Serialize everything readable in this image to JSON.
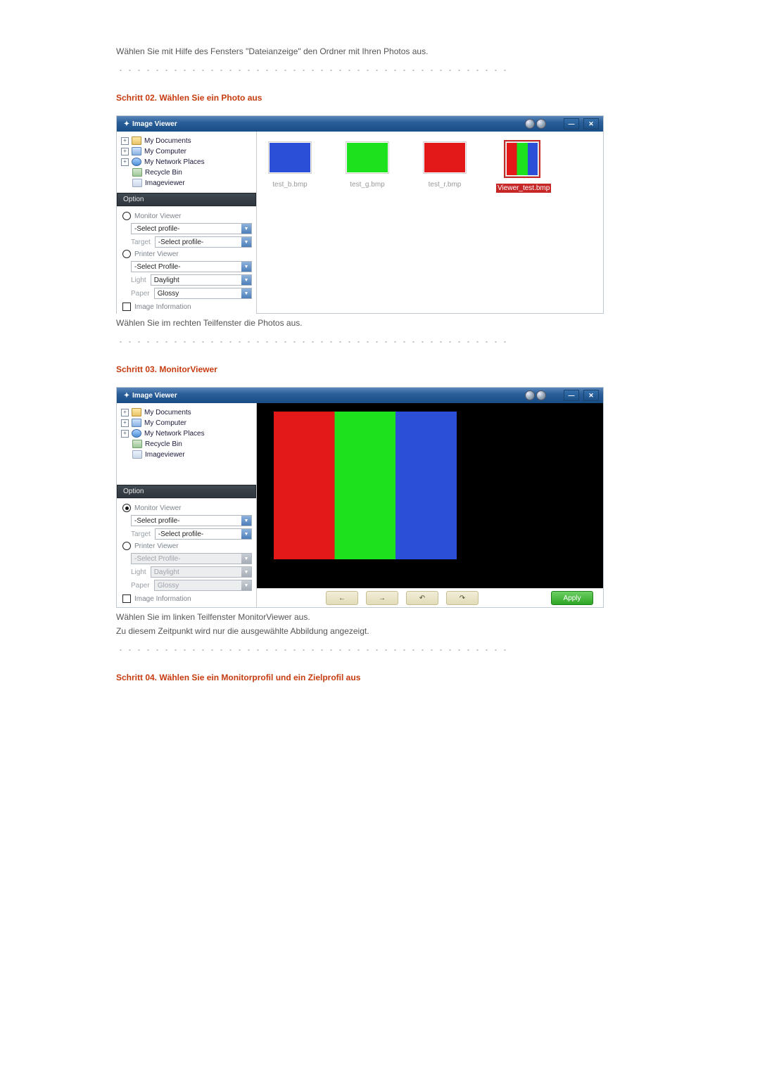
{
  "intro_text": "Wählen Sie mit Hilfe des Fensters \"Dateianzeige\" den Ordner mit Ihren Photos aus.",
  "step2": {
    "title": "Schritt 02. Wählen Sie ein Photo aus",
    "caption": "Wählen Sie im rechten Teilfenster die Photos aus."
  },
  "step3": {
    "title": "Schritt 03. MonitorViewer",
    "caption1": "Wählen Sie im linken Teilfenster MonitorViewer aus.",
    "caption2": "Zu diesem Zeitpunkt wird nur die ausgewählte Abbildung angezeigt."
  },
  "step4": {
    "title": "Schritt 04. Wählen Sie ein Monitorprofil und ein Zielprofil aus"
  },
  "app": {
    "title": "Image Viewer",
    "tree": {
      "my_documents": "My Documents",
      "my_computer": "My Computer",
      "my_network_places": "My Network Places",
      "recycle_bin": "Recycle Bin",
      "imageviewer": "Imageviewer"
    },
    "option_header": "Option",
    "monitor_viewer": "Monitor Viewer",
    "printer_viewer": "Printer Viewer",
    "select_profile": "-Select profile-",
    "select_profile_cap": "-Select Profile-",
    "target_label": "Target",
    "light_label": "Light",
    "paper_label": "Paper",
    "daylight": "Daylight",
    "glossy": "Glossy",
    "image_information": "Image Information",
    "thumbs": {
      "b": "test_b.bmp",
      "g": "test_g.bmp",
      "r": "test_r.bmp",
      "sel": "Viewer_test.bmp"
    },
    "apply": "Apply"
  }
}
